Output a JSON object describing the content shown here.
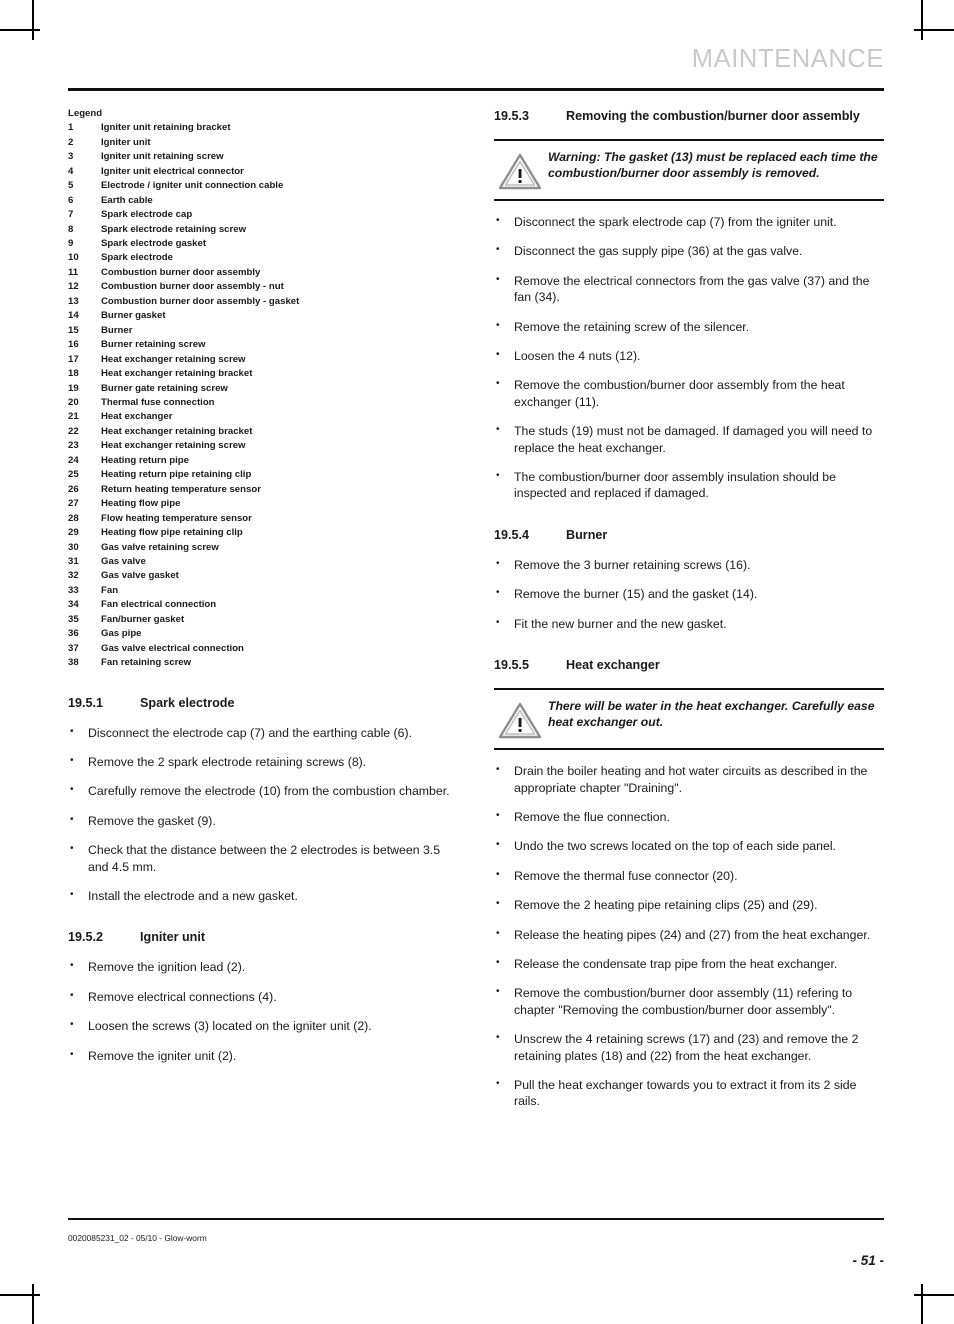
{
  "header": {
    "title": "MAINTENANCE",
    "title_color": "#c9c9c9"
  },
  "legend": {
    "title": "Legend",
    "items": [
      {
        "num": "1",
        "label": "Igniter unit retaining bracket"
      },
      {
        "num": "2",
        "label": "Igniter unit"
      },
      {
        "num": "3",
        "label": "Igniter unit retaining screw"
      },
      {
        "num": "4",
        "label": "Igniter unit electrical connector"
      },
      {
        "num": "5",
        "label": "Electrode / igniter unit connection cable"
      },
      {
        "num": "6",
        "label": "Earth cable"
      },
      {
        "num": "7",
        "label": "Spark electrode cap"
      },
      {
        "num": "8",
        "label": "Spark electrode retaining screw"
      },
      {
        "num": "9",
        "label": "Spark electrode gasket"
      },
      {
        "num": "10",
        "label": "Spark electrode"
      },
      {
        "num": "11",
        "label": "Combustion burner door assembly"
      },
      {
        "num": "12",
        "label": "Combustion burner door assembly - nut"
      },
      {
        "num": "13",
        "label": "Combustion burner door assembly - gasket"
      },
      {
        "num": "14",
        "label": "Burner gasket"
      },
      {
        "num": "15",
        "label": "Burner"
      },
      {
        "num": "16",
        "label": "Burner retaining screw"
      },
      {
        "num": "17",
        "label": "Heat exchanger retaining screw"
      },
      {
        "num": "18",
        "label": "Heat exchanger retaining bracket"
      },
      {
        "num": "19",
        "label": "Burner gate retaining screw"
      },
      {
        "num": "20",
        "label": "Thermal fuse connection"
      },
      {
        "num": "21",
        "label": "Heat exchanger"
      },
      {
        "num": "22",
        "label": "Heat exchanger retaining bracket"
      },
      {
        "num": "23",
        "label": "Heat exchanger retaining screw"
      },
      {
        "num": "24",
        "label": "Heating return pipe"
      },
      {
        "num": "25",
        "label": "Heating return pipe retaining clip"
      },
      {
        "num": "26",
        "label": "Return heating temperature sensor"
      },
      {
        "num": "27",
        "label": "Heating flow pipe"
      },
      {
        "num": "28",
        "label": "Flow heating temperature sensor"
      },
      {
        "num": "29",
        "label": "Heating flow pipe retaining clip"
      },
      {
        "num": "30",
        "label": "Gas valve retaining screw"
      },
      {
        "num": "31",
        "label": "Gas valve"
      },
      {
        "num": "32",
        "label": "Gas valve gasket"
      },
      {
        "num": "33",
        "label": "Fan"
      },
      {
        "num": "34",
        "label": "Fan electrical connection"
      },
      {
        "num": "35",
        "label": "Fan/burner gasket"
      },
      {
        "num": "36",
        "label": "Gas pipe"
      },
      {
        "num": "37",
        "label": "Gas valve electrical connection"
      },
      {
        "num": "38",
        "label": "Fan retaining screw"
      }
    ]
  },
  "sections": {
    "spark_electrode": {
      "number": "19.5.1",
      "title": "Spark electrode",
      "bullets": [
        "Disconnect the electrode cap (7) and the earthing cable (6).",
        "Remove the 2 spark electrode retaining screws (8).",
        "Carefully remove the electrode (10) from the combustion chamber.",
        "Remove the gasket (9).",
        "Check that the distance between the 2 electrodes is between 3.5 and 4.5 mm.",
        "Install the electrode and a new gasket."
      ]
    },
    "igniter_unit": {
      "number": "19.5.2",
      "title": "Igniter unit",
      "bullets": [
        "Remove the ignition lead (2).",
        "Remove electrical connections (4).",
        "Loosen the screws (3) located on the igniter unit (2).",
        "Remove the igniter unit (2)."
      ]
    },
    "removing_door": {
      "number": "19.5.3",
      "title": "Removing the combustion/burner door assembly",
      "warning": "Warning: The gasket (13) must be replaced each time the combustion/burner door assembly is removed.",
      "bullets": [
        "Disconnect the spark electrode cap (7) from the igniter unit.",
        "Disconnect the gas supply pipe (36) at the gas valve.",
        "Remove the electrical connectors from the gas valve (37) and the fan (34).",
        "Remove the retaining screw of the silencer.",
        "Loosen the 4 nuts (12).",
        "Remove the combustion/burner door assembly from the heat exchanger (11).",
        "The studs (19) must not be damaged. If damaged you will need to replace the heat exchanger.",
        "The combustion/burner door assembly insulation should be inspected and replaced if damaged."
      ]
    },
    "burner": {
      "number": "19.5.4",
      "title": "Burner",
      "bullets": [
        "Remove the 3 burner retaining screws (16).",
        "Remove the burner (15) and the gasket (14).",
        "Fit the new burner and the new gasket."
      ]
    },
    "heat_exchanger": {
      "number": "19.5.5",
      "title": "Heat exchanger",
      "warning": "There will be water in the heat exchanger. Carefully ease heat exchanger out.",
      "bullets": [
        "Drain the boiler heating and hot water circuits as described in the appropriate chapter \"Draining\".",
        "Remove the flue connection.",
        "Undo the two screws located on the top of each side panel.",
        "Remove the thermal fuse connector (20).",
        "Remove the 2 heating pipe retaining clips (25) and (29).",
        "Release the heating pipes (24) and (27) from the heat exchanger.",
        "Release the condensate trap pipe from the heat exchanger.",
        "Remove the combustion/burner door assembly (11) refering to chapter \"Removing the combustion/burner door assembly\".",
        "Unscrew the 4 retaining screws (17) and (23) and remove the 2 retaining plates (18) and (22) from the heat exchanger.",
        "Pull the heat exchanger towards you to extract it from its 2 side rails."
      ]
    }
  },
  "footer": {
    "reference": "0020085231_02 - 05/10 - Glow-worm",
    "page": "- 51 -"
  },
  "icons": {
    "warning": "warning-triangle-icon"
  }
}
